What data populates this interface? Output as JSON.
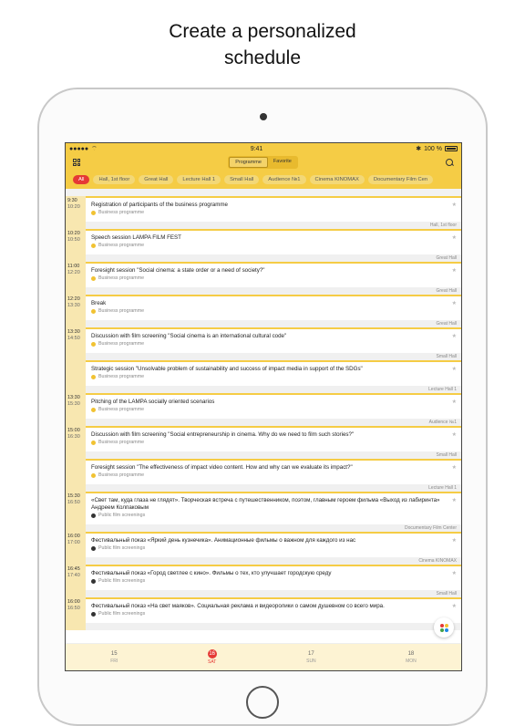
{
  "headline": [
    "Create a personalized",
    "schedule"
  ],
  "status": {
    "time": "9:41",
    "battery": "100 %"
  },
  "nav": {
    "tabs": [
      "Programme",
      "Favorite"
    ],
    "active_tab": 0
  },
  "filters": [
    "All",
    "Hall, 1st floor",
    "Great Hall",
    "Lecture Hall 1",
    "Small Hall",
    "Audience №1",
    "Cinema KINOMAX",
    "Documentary Film Cen"
  ],
  "events": [
    {
      "start": "9:30",
      "end": "10:20",
      "title": "Registration of participants of the business programme",
      "tag": "Business programme",
      "hall": "Hall, 1st floor",
      "dark": false
    },
    {
      "start": "10:20",
      "end": "10:50",
      "title": "Speech session LAMPA FILM FEST",
      "tag": "Business programme",
      "hall": "Great Hall",
      "dark": false
    },
    {
      "start": "11:00",
      "end": "12:20",
      "title": "Foresight session \"Social cinema: a state order or a need of society?\"",
      "tag": "Business programme",
      "hall": "Great Hall",
      "dark": false
    },
    {
      "start": "12:20",
      "end": "13:30",
      "title": "Break",
      "tag": "Business programme",
      "hall": "Great Hall",
      "dark": false
    },
    {
      "start": "13:30",
      "end": "14:50",
      "title": "Discussion with film screening \"Social cinema is an international cultural code\"",
      "tag": "Business programme",
      "hall": "Small Hall",
      "dark": false
    },
    {
      "start": "",
      "end": "",
      "title": "Strategic session \"Unsolvable problem of sustainability and success of impact media in support of the SDGs\"",
      "tag": "Business programme",
      "hall": "Lecture Hall 1",
      "dark": false
    },
    {
      "start": "13:30",
      "end": "15:30",
      "title": "Pitching of the LAMPA socially oriented scenarios",
      "tag": "Business programme",
      "hall": "Audience №1",
      "dark": false
    },
    {
      "start": "15:00",
      "end": "16:30",
      "title": "Discussion with film screening \"Social entrepreneurship in cinema. Why do we need to film such stories?\"",
      "tag": "Business programme",
      "hall": "Small Hall",
      "dark": false
    },
    {
      "start": "",
      "end": "",
      "title": "Foresight session \"The effectiveness of impact video content. How and why can we evaluate its impact?\"",
      "tag": "Business programme",
      "hall": "Lecture Hall 1",
      "dark": false
    },
    {
      "start": "15:30",
      "end": "16:50",
      "title": "«Свет там, куда глаза не глядят». Творческая встреча с путешественником, поэтом, главным героем фильма «Выход из лабиринта» Андреем Колпаковым",
      "tag": "Public film screenings",
      "hall": "Documentary Film Center",
      "dark": true
    },
    {
      "start": "16:00",
      "end": "17:00",
      "title": "Фестивальный показ «Яркий день кузнечика». Анимационные фильмы о важном для каждого из нас",
      "tag": "Public film screenings",
      "hall": "Cinema KINOMAX",
      "dark": true
    },
    {
      "start": "16:45",
      "end": "17:40",
      "title": "Фестивальный показ «Город светлее с кино». Фильмы о тех, кто улучшает городскую среду",
      "tag": "Public film screenings",
      "hall": "Small Hall",
      "dark": true
    },
    {
      "start": "16:00",
      "end": "16:50",
      "title": "Фестивальный показ «На свет маяков». Социальная реклама и видеоролики о самом душевном со всего мира.",
      "tag": "Public film screenings",
      "hall": "",
      "dark": true
    }
  ],
  "days": [
    {
      "num": "15",
      "wd": "FRI",
      "selected": false
    },
    {
      "num": "16",
      "wd": "SAT",
      "selected": true
    },
    {
      "num": "17",
      "wd": "SUN",
      "selected": false
    },
    {
      "num": "18",
      "wd": "MON",
      "selected": false
    }
  ],
  "fab_colors": [
    "#e53935",
    "#f1c232",
    "#43a047",
    "#1e88e5"
  ]
}
